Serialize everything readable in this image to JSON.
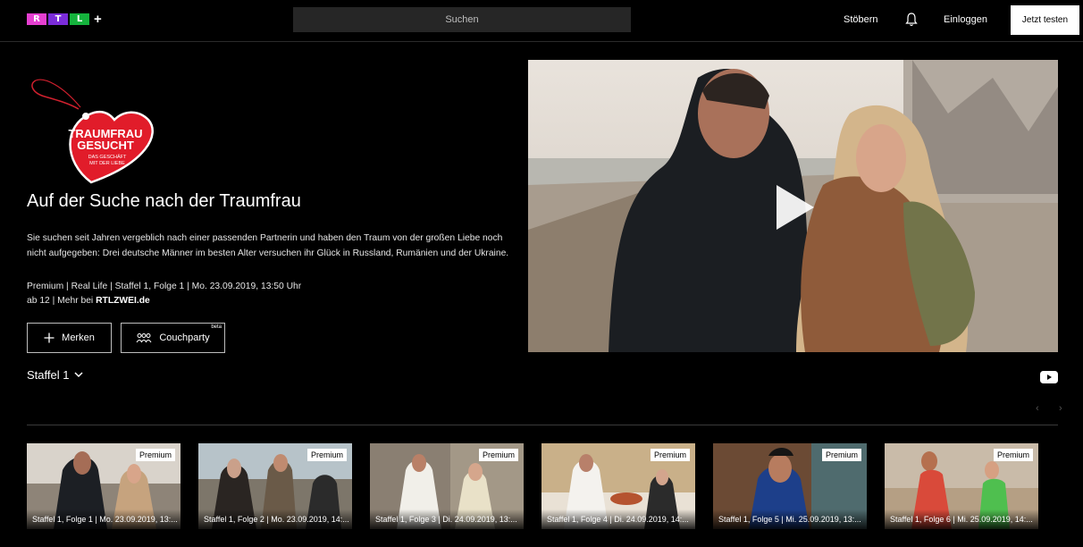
{
  "header": {
    "logo_letters": [
      "R",
      "T",
      "L"
    ],
    "logo_colors": [
      "#e53fd0",
      "#7b2cd9",
      "#15b33d"
    ],
    "logo_plus": "+",
    "search_placeholder": "Suchen",
    "browse_label": "Stöbern",
    "bell_icon": "bell-icon",
    "login_label": "Einloggen",
    "cta_label": "Jetzt testen"
  },
  "show": {
    "logo_text_main1": "TRAUMFRAU",
    "logo_text_main2": "GESUCHT",
    "logo_text_sub1": "DAS GESCHÄFT",
    "logo_text_sub2": "MIT DER LIEBE",
    "title": "Auf der Suche nach der Traumfrau",
    "description": "Sie suchen seit Jahren vergeblich nach einer passenden Partnerin und haben den Traum von der großen Liebe noch nicht aufgegeben: Drei deutsche Männer im besten Alter versuchen ihr Glück in Russland, Rumänien und der Ukraine.",
    "meta_line1": "Premium | Real Life | Staffel 1, Folge 1 | Mo. 23.09.2019, 13:50 Uhr",
    "meta_line2_prefix": "ab 12 | Mehr bei ",
    "meta_line2_link": "RTLZWEI.de",
    "bookmark_label": "Merken",
    "couchparty_label": "Couchparty",
    "couchparty_badge": "beta",
    "season_selector": "Staffel 1",
    "play_icon": "play-icon",
    "youtube_icon": "youtube-icon"
  },
  "episodes": [
    {
      "badge": "Premium",
      "caption": "Staffel 1, Folge 1 | Mo. 23.09.2019, 13:..."
    },
    {
      "badge": "Premium",
      "caption": "Staffel 1, Folge 2 | Mo. 23.09.2019, 14:..."
    },
    {
      "badge": "Premium",
      "caption": "Staffel 1, Folge 3 | Di. 24.09.2019, 13:..."
    },
    {
      "badge": "Premium",
      "caption": "Staffel 1, Folge 4 | Di. 24.09.2019, 14:..."
    },
    {
      "badge": "Premium",
      "caption": "Staffel 1, Folge 5 | Mi. 25.09.2019, 13:..."
    },
    {
      "badge": "Premium",
      "caption": "Staffel 1, Folge 6 | Mi. 25.09.2019, 14:..."
    }
  ],
  "carousel": {
    "prev_label": "‹",
    "next_label": "›"
  }
}
